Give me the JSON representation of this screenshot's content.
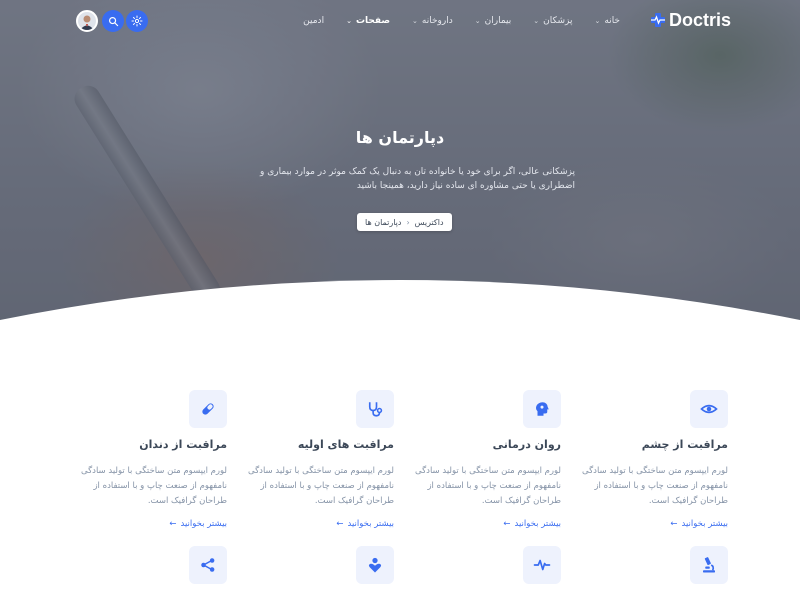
{
  "brand": {
    "name": "Doctris"
  },
  "nav": {
    "items": [
      {
        "label": "خانه",
        "caret": "⌄"
      },
      {
        "label": "پزشکان",
        "caret": "⌄"
      },
      {
        "label": "بیماران",
        "caret": "⌄"
      },
      {
        "label": "داروخانه",
        "caret": "⌄"
      },
      {
        "label": "صفحات",
        "caret": "⌄"
      },
      {
        "label": "ادمین"
      }
    ]
  },
  "hero": {
    "title": "دپارتمان ها",
    "description": "پزشکانی عالی، اگر برای خود یا خانواده تان به دنبال یک کمک موثر در موارد بیماری و اضطراری یا حتی مشاوره ای ساده نیاز دارید، همینجا باشید",
    "breadcrumb": {
      "home": "داکتریس",
      "current": "دپارتمان ها",
      "separator": "‹"
    }
  },
  "departments": [
    {
      "title": "مراقبت از چشم",
      "icon": "eye-icon",
      "text": "لورم ایپسوم متن ساختگی با تولید سادگی نامفهوم از صنعت چاپ و با استفاده از طراحان گرافیک است.",
      "link": "بیشتر بخوانید",
      "arrow": "←"
    },
    {
      "title": "روان درمانی",
      "icon": "brain-head-icon",
      "text": "لورم ایپسوم متن ساختگی با تولید سادگی نامفهوم از صنعت چاپ و با استفاده از طراحان گرافیک است.",
      "link": "بیشتر بخوانید",
      "arrow": "←"
    },
    {
      "title": "مراقبت های اولیه",
      "icon": "stethoscope-icon",
      "text": "لورم ایپسوم متن ساختگی با تولید سادگی نامفهوم از صنعت چاپ و با استفاده از طراحان گرافیک است.",
      "link": "بیشتر بخوانید",
      "arrow": "←"
    },
    {
      "title": "مراقبت از دندان",
      "icon": "pill-icon",
      "text": "لورم ایپسوم متن ساختگی با تولید سادگی نامفهوم از صنعت چاپ و با استفاده از طراحان گرافیک است.",
      "link": "بیشتر بخوانید",
      "arrow": "←"
    },
    {
      "icon": "microscope-icon"
    },
    {
      "icon": "heartbeat-icon"
    },
    {
      "icon": "user-heart-icon"
    },
    {
      "icon": "share-nodes-icon"
    }
  ],
  "colors": {
    "primary": "#396cf0",
    "heading": "#3c4858",
    "muted": "#8492a6",
    "icon_bg": "#eef2fd"
  }
}
